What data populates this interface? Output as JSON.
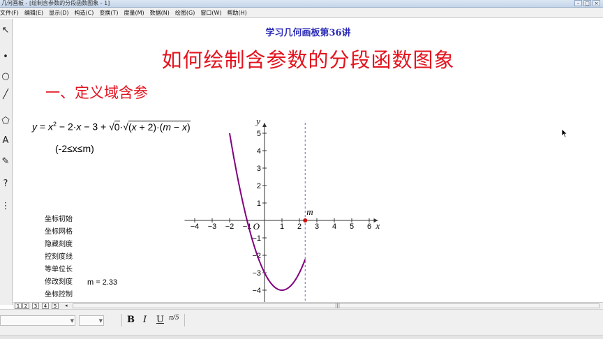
{
  "window": {
    "title": "几何画板 - [绘制含参数的分段函数图象 - 1]",
    "controls": [
      "–",
      "□",
      "×"
    ]
  },
  "menu": [
    "文件(F)",
    "编辑(E)",
    "显示(D)",
    "构造(C)",
    "变换(T)",
    "度量(M)",
    "数据(N)",
    "绘图(G)",
    "窗口(W)",
    "帮助(H)"
  ],
  "toolbox": {
    "tools": [
      {
        "name": "selection-arrow-icon",
        "glyph": "↖"
      },
      {
        "name": "point-tool-icon",
        "glyph": "•"
      },
      {
        "name": "compass-tool-icon",
        "glyph": "○"
      },
      {
        "name": "straightedge-tool-icon",
        "glyph": "╱"
      },
      {
        "name": "polygon-tool-icon",
        "glyph": "⬠"
      },
      {
        "name": "text-tool-icon",
        "glyph": "A"
      },
      {
        "name": "marker-tool-icon",
        "glyph": "✎"
      },
      {
        "name": "info-tool-icon",
        "glyph": "?"
      },
      {
        "name": "custom-tool-icon",
        "glyph": "⋮"
      }
    ]
  },
  "canvas": {
    "lecture_title": "学习几何画板第36讲",
    "main_title": "如何绘制含参数的分段函数图象",
    "section_title": "一、定义域含参",
    "formula": {
      "y": "y",
      "eq": " = ",
      "x1": "x",
      "sq": "2",
      "rest1": " − 2·",
      "x2": "x",
      "rest2": " − 3 + ",
      "root": "√",
      "zero": "0",
      "dot": "·",
      "open": "(",
      "x3": "x",
      "plus": " + 2)·(",
      "m": "m",
      "minus": " − ",
      "x4": "x",
      "close": ")"
    },
    "domain": "(-2≤x≤m)",
    "action_buttons": [
      "坐标初始",
      "坐标网格",
      "隐藏刻度",
      "控刻度线",
      "等单位长",
      "修改刻度",
      "坐标控制"
    ],
    "parameter_readout": "m = 2.33"
  },
  "chart_data": {
    "type": "line",
    "title": "",
    "xlabel": "x",
    "ylabel": "y",
    "origin_label": "O",
    "xlim": [
      -4.5,
      6.5
    ],
    "ylim": [
      -4.7,
      5.6
    ],
    "x_ticks": [
      -4,
      -3,
      -2,
      -1,
      1,
      2,
      3,
      4,
      5,
      6
    ],
    "y_ticks": [
      -4,
      -3,
      -2,
      -1,
      1,
      2,
      3,
      4,
      5
    ],
    "grid": false,
    "series": [
      {
        "function": "x^2 - 2x - 3",
        "domain": [
          -2,
          2.33
        ],
        "color": "#800080"
      }
    ],
    "parameter": {
      "name": "m",
      "value": 2.33,
      "color": "#cc1111"
    },
    "guide_line": {
      "x": 2.33,
      "style": "dashed",
      "color": "#6a6ab0"
    }
  },
  "pagebar": {
    "tabs": [
      "1",
      "2",
      "3",
      "4",
      "5"
    ],
    "nav": "◂",
    "grip": "|||"
  },
  "formatbar": {
    "font_value": "",
    "size_value": "",
    "buttons": [
      "B",
      "I",
      "U"
    ],
    "math_format": "π/5"
  }
}
